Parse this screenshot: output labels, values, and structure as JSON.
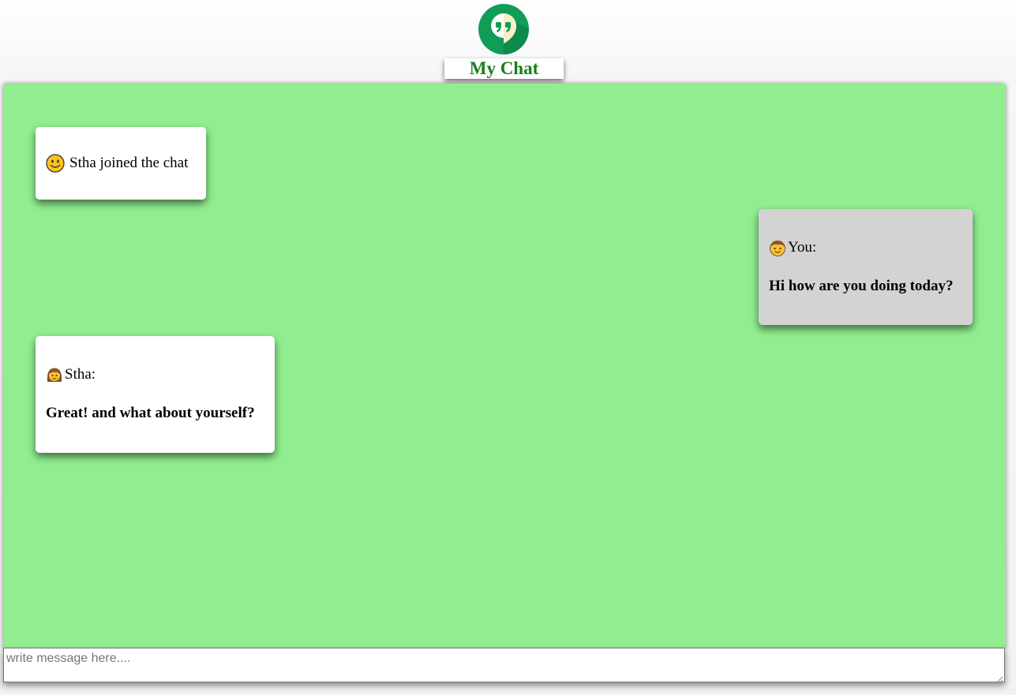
{
  "header": {
    "logo_icon": "hangouts-quote-icon",
    "title": "My Chat",
    "title_color": "#178017"
  },
  "chat": {
    "background_color": "#90ee90",
    "events": [
      {
        "type": "join",
        "icon": "smiley-face-icon",
        "text": "Stha joined the chat"
      }
    ],
    "messages": [
      {
        "side": "right",
        "sender_icon": "boy-face-icon",
        "sender": "You:",
        "text": "Hi how are you doing today?",
        "bubble_color": "#d3d3d3"
      },
      {
        "side": "left",
        "sender_icon": "girl-face-icon",
        "sender": "Stha:",
        "text": "Great! and what about yourself?",
        "bubble_color": "#ffffff"
      }
    ]
  },
  "composer": {
    "placeholder": "write message here....",
    "value": ""
  }
}
